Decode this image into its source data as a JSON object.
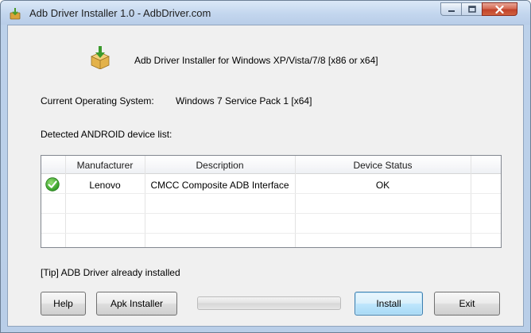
{
  "window": {
    "title": "Adb Driver Installer 1.0  -  AdbDriver.com"
  },
  "header": {
    "text": "Adb Driver Installer for Windows XP/Vista/7/8 [x86 or x64]",
    "icon": "install-package-icon"
  },
  "os": {
    "label": "Current Operating System:",
    "value": "Windows 7 Service Pack 1 [x64]"
  },
  "devices": {
    "label": "Detected ANDROID device list:",
    "columns": [
      "",
      "Manufacturer",
      "Description",
      "Device Status"
    ],
    "rows": [
      {
        "status_icon": "check-ok-icon",
        "manufacturer": "Lenovo",
        "description": "CMCC Composite ADB Interface",
        "status": "OK"
      }
    ]
  },
  "tip": "[Tip] ADB Driver already installed",
  "progress": {
    "value": 0
  },
  "buttons": {
    "help": "Help",
    "apk_installer": "Apk Installer",
    "install": "Install",
    "exit": "Exit"
  },
  "colors": {
    "ok_green": "#3aa335",
    "install_focus_border": "#3c7fb1",
    "close_red": "#c2432a"
  }
}
